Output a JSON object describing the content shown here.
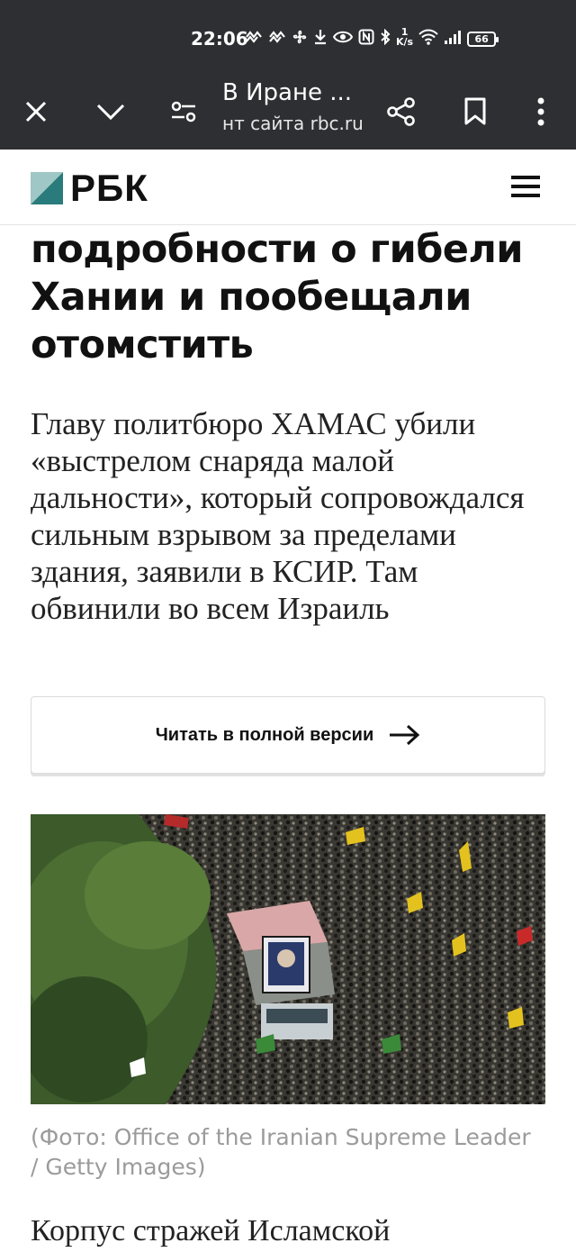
{
  "status_bar": {
    "time": "22:06",
    "net_speed_value": "1",
    "net_speed_unit": "K/s",
    "battery": "66",
    "icons": [
      "notification-icon",
      "notification-icon",
      "fan-icon",
      "download-icon",
      "eye-icon",
      "nfc-icon",
      "bluetooth-icon",
      "wifi-icon",
      "signal-icon",
      "battery-icon"
    ]
  },
  "browser": {
    "page_title": "В Иране ...",
    "url": "нт сайта rbc.ru",
    "buttons": [
      "close-icon",
      "chevron-down-icon",
      "settings-icon",
      "share-icon",
      "bookmark-icon",
      "more-vert-icon"
    ]
  },
  "site": {
    "logo_text": "РБК",
    "menu_icon": "hamburger-icon"
  },
  "article": {
    "headline": "В Иране рассказали подробности о гибели Хании и пообещали отомстить",
    "subtitle": "Главу политбюро ХАМАС убили «выстрелом снаряда малой дальности», который сопровождался сильным взрывом за пределами здания, заявили в КСИР. Там обвинили во всем Израиль",
    "read_full_label": "Читать в полной версии",
    "photo_caption": "(Фото: Office of the Iranian Supreme Leader / Getty Images)",
    "body_start": "Корпус стражей Исламской"
  },
  "colors": {
    "browser_bar": "#2e2f33",
    "logo_teal": "#2a7b7b",
    "logo_light": "#9fc7c5",
    "text": "#111111",
    "caption": "#9b9b9b"
  }
}
